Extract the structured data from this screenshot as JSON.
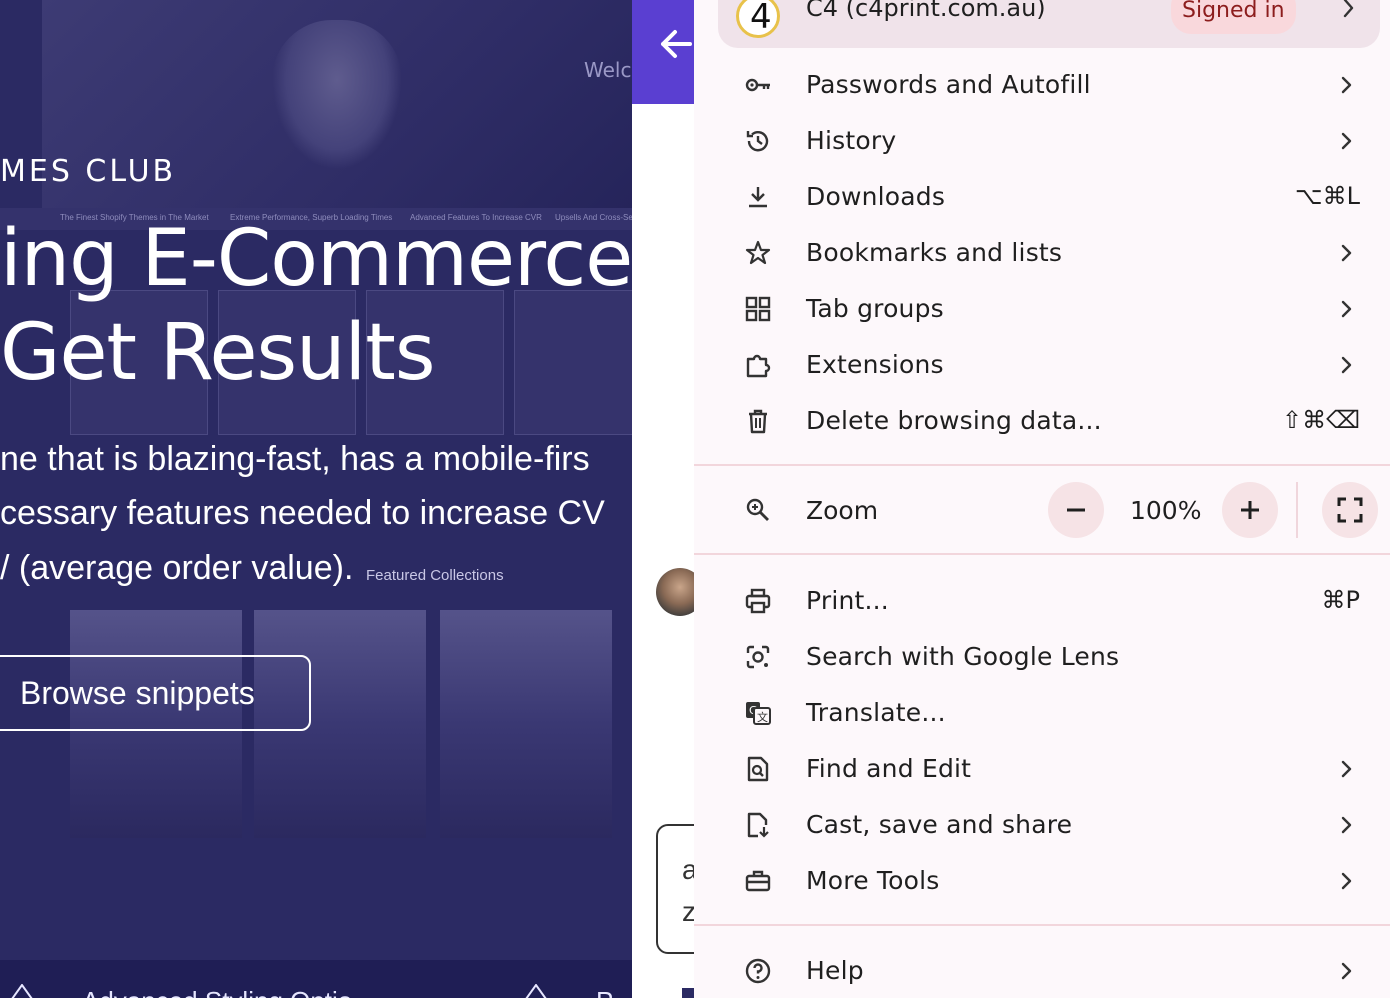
{
  "background_page": {
    "welcome_text": "Welco",
    "strip_items": [
      "The Finest Shopify Themes in The Market",
      "Extreme Performance, Superb Loading Times",
      "Advanced Features To Increase CVR",
      "Upsells And Cross-Sel"
    ],
    "hero_subtitle": "MES CLUB",
    "hero_title_line1": "ing E-Commerce",
    "hero_title_line2": "Get Results",
    "hero_desc_line1": "ne that is blazing-fast, has a mobile-firs",
    "hero_desc_line2": "cessary features needed to increase CV",
    "hero_desc_line3": "/ (average order value).",
    "featured_collections": "Featured Collections",
    "browse_button": "Browse snippets",
    "bottom_text_1": "Advanced Styling Optio",
    "bottom_text_2": "P"
  },
  "side_panel": {
    "back_icon": "arrow-left-icon",
    "box_text_1": "a",
    "box_text_2": "z"
  },
  "menu": {
    "profile": {
      "avatar_text": "4",
      "name": "C4 (c4print.com.au)",
      "badge": "Signed in"
    },
    "items": [
      {
        "label": "Passwords and Autofill",
        "icon": "key-icon",
        "shortcut": "",
        "submenu": true
      },
      {
        "label": "History",
        "icon": "history-icon",
        "shortcut": "",
        "submenu": true
      },
      {
        "label": "Downloads",
        "icon": "download-icon",
        "shortcut": "⌥⌘L",
        "submenu": false
      },
      {
        "label": "Bookmarks and lists",
        "icon": "star-icon",
        "shortcut": "",
        "submenu": true
      },
      {
        "label": "Tab groups",
        "icon": "tab-groups-icon",
        "shortcut": "",
        "submenu": true
      },
      {
        "label": "Extensions",
        "icon": "puzzle-icon",
        "shortcut": "",
        "submenu": true
      },
      {
        "label": "Delete browsing data...",
        "icon": "trash-icon",
        "shortcut": "⇧⌘⌫",
        "submenu": false
      }
    ],
    "zoom": {
      "label": "Zoom",
      "value": "100%",
      "minus": "−",
      "plus": "+"
    },
    "items2": [
      {
        "label": "Print...",
        "icon": "print-icon",
        "shortcut": "⌘P",
        "submenu": false
      },
      {
        "label": "Search with Google Lens",
        "icon": "lens-icon",
        "shortcut": "",
        "submenu": false
      },
      {
        "label": "Translate...",
        "icon": "translate-icon",
        "shortcut": "",
        "submenu": false
      },
      {
        "label": "Find and Edit",
        "icon": "find-icon",
        "shortcut": "",
        "submenu": true
      },
      {
        "label": "Cast, save and share",
        "icon": "cast-save-icon",
        "shortcut": "",
        "submenu": true
      },
      {
        "label": "More Tools",
        "icon": "toolbox-icon",
        "shortcut": "",
        "submenu": true
      }
    ],
    "help": {
      "label": "Help",
      "icon": "help-icon",
      "submenu": true
    },
    "colors": {
      "background": "#fdf8fb",
      "divider": "#f2d6dc",
      "badge_bg": "#f9d8dc",
      "badge_text": "#8c1d1d",
      "accent": "#5a3fd1"
    }
  }
}
